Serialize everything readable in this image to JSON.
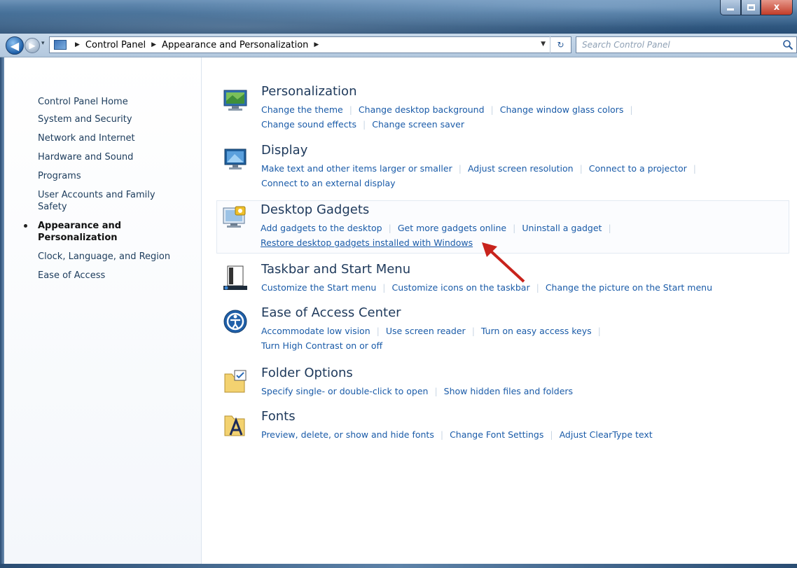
{
  "window": {
    "controls": {
      "minimize": "",
      "maximize": "",
      "close": "x"
    }
  },
  "navigation": {
    "back_icon": "back-arrow-icon",
    "forward_icon": "forward-arrow-icon",
    "breadcrumbs": [
      "Control Panel",
      "Appearance and Personalization"
    ],
    "refresh_glyph": "↻",
    "search_placeholder": "Search Control Panel"
  },
  "sidebar": {
    "home": "Control Panel Home",
    "items": [
      {
        "label": "System and Security",
        "active": false
      },
      {
        "label": "Network and Internet",
        "active": false
      },
      {
        "label": "Hardware and Sound",
        "active": false
      },
      {
        "label": "Programs",
        "active": false
      },
      {
        "label": "User Accounts and Family Safety",
        "active": false
      },
      {
        "label": "Appearance and Personalization",
        "active": true
      },
      {
        "label": "Clock, Language, and Region",
        "active": false
      },
      {
        "label": "Ease of Access",
        "active": false
      }
    ]
  },
  "categories": [
    {
      "title": "Personalization",
      "icon": "personalization-icon",
      "links": [
        "Change the theme",
        "Change desktop background",
        "Change window glass colors",
        "Change sound effects",
        "Change screen saver"
      ]
    },
    {
      "title": "Display",
      "icon": "display-icon",
      "links": [
        "Make text and other items larger or smaller",
        "Adjust screen resolution",
        "Connect to a projector",
        "Connect to an external display"
      ]
    },
    {
      "title": "Desktop Gadgets",
      "icon": "desktop-gadgets-icon",
      "links": [
        "Add gadgets to the desktop",
        "Get more gadgets online",
        "Uninstall a gadget",
        "Restore desktop gadgets installed with Windows"
      ]
    },
    {
      "title": "Taskbar and Start Menu",
      "icon": "taskbar-icon",
      "links": [
        "Customize the Start menu",
        "Customize icons on the taskbar",
        "Change the picture on the Start menu"
      ]
    },
    {
      "title": "Ease of Access Center",
      "icon": "ease-of-access-icon",
      "links": [
        "Accommodate low vision",
        "Use screen reader",
        "Turn on easy access keys",
        "Turn High Contrast on or off"
      ]
    },
    {
      "title": "Folder Options",
      "icon": "folder-options-icon",
      "links": [
        "Specify single- or double-click to open",
        "Show hidden files and folders"
      ]
    },
    {
      "title": "Fonts",
      "icon": "fonts-icon",
      "links": [
        "Preview, delete, or show and hide fonts",
        "Change Font Settings",
        "Adjust ClearType text"
      ]
    }
  ],
  "annotation": {
    "icon": "red-arrow-icon",
    "color": "#c8231c"
  }
}
